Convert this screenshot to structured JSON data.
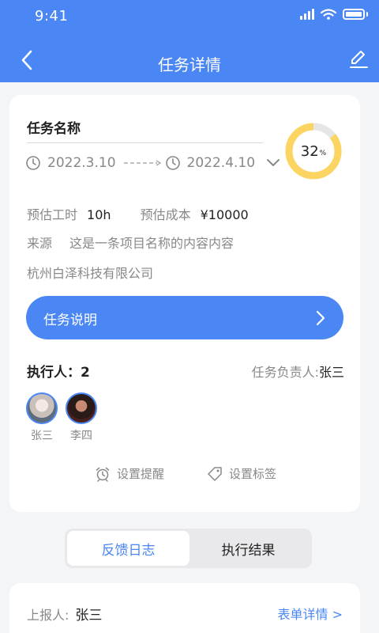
{
  "status_bar": {
    "time": "9:41"
  },
  "header": {
    "title": "任务详情"
  },
  "task": {
    "name": "任务名称",
    "start_date": "2022.3.10",
    "end_date": "2022.4.10",
    "progress": 32,
    "progress_label": "32",
    "progress_unit": "%",
    "estimate_hours_label": "预估工时",
    "estimate_hours_value": "10h",
    "estimate_cost_label": "预估成本",
    "estimate_cost_value": "¥10000",
    "source_label": "来源",
    "source_value": "这是一条项目名称的内容内容",
    "company": "杭州白泽科技有限公司"
  },
  "description_button": {
    "label": "任务说明"
  },
  "executors": {
    "title": "执行人：2",
    "owner_label": "任务负责人:",
    "owner_name": "张三",
    "people": [
      "张三",
      "李四"
    ]
  },
  "actions": {
    "reminder": "设置提醒",
    "tags": "设置标签"
  },
  "tabs": {
    "feedback": "反馈日志",
    "result": "执行结果"
  },
  "report": {
    "reporter_label": "上报人:",
    "reporter_name": "张三",
    "form_link": "表单详情 >"
  },
  "colors": {
    "primary": "#4a86f4",
    "progress": "#fcd462",
    "track": "#e6e6e6"
  }
}
